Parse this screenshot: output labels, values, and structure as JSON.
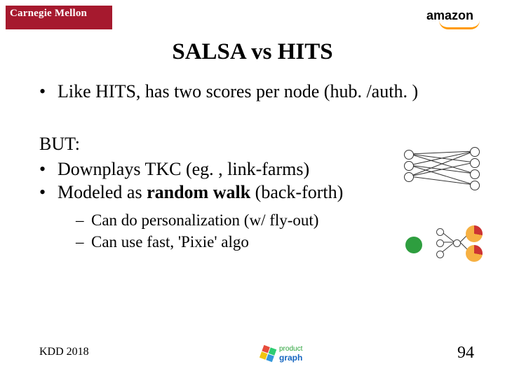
{
  "header": {
    "cmu": "Carnegie Mellon",
    "amazon": "amazon"
  },
  "title": "SALSA vs HITS",
  "top_bullet": "Like HITS, has two scores per node (hub. /auth. )",
  "but_label": "BUT:",
  "mid_bullets": [
    {
      "pre": "Downplays TKC (eg. , link-farms)",
      "bold": "",
      "post": ""
    },
    {
      "pre": "Modeled as ",
      "bold": "random walk",
      "post": " (back-forth)"
    }
  ],
  "sub_bullets": [
    "Can do personalization (w/ fly-out)",
    "Can use fast, 'Pixie' algo"
  ],
  "footer": {
    "venue": "KDD 2018",
    "page": "94",
    "logo_top": "product",
    "logo_bottom": "graph"
  }
}
